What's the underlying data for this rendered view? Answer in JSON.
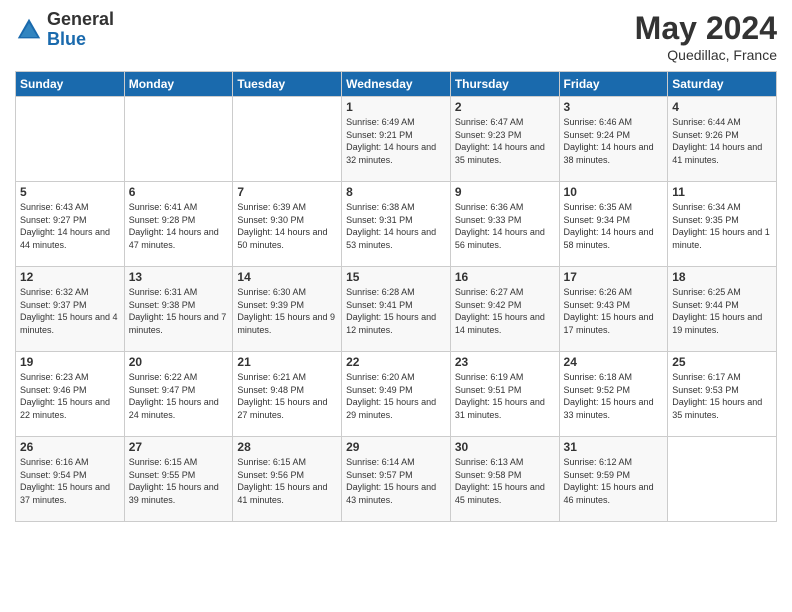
{
  "logo": {
    "general": "General",
    "blue": "Blue"
  },
  "header": {
    "month": "May 2024",
    "location": "Quedillac, France"
  },
  "days_of_week": [
    "Sunday",
    "Monday",
    "Tuesday",
    "Wednesday",
    "Thursday",
    "Friday",
    "Saturday"
  ],
  "weeks": [
    [
      {
        "day": "",
        "info": ""
      },
      {
        "day": "",
        "info": ""
      },
      {
        "day": "",
        "info": ""
      },
      {
        "day": "1",
        "info": "Sunrise: 6:49 AM\nSunset: 9:21 PM\nDaylight: 14 hours and 32 minutes."
      },
      {
        "day": "2",
        "info": "Sunrise: 6:47 AM\nSunset: 9:23 PM\nDaylight: 14 hours and 35 minutes."
      },
      {
        "day": "3",
        "info": "Sunrise: 6:46 AM\nSunset: 9:24 PM\nDaylight: 14 hours and 38 minutes."
      },
      {
        "day": "4",
        "info": "Sunrise: 6:44 AM\nSunset: 9:26 PM\nDaylight: 14 hours and 41 minutes."
      }
    ],
    [
      {
        "day": "5",
        "info": "Sunrise: 6:43 AM\nSunset: 9:27 PM\nDaylight: 14 hours and 44 minutes."
      },
      {
        "day": "6",
        "info": "Sunrise: 6:41 AM\nSunset: 9:28 PM\nDaylight: 14 hours and 47 minutes."
      },
      {
        "day": "7",
        "info": "Sunrise: 6:39 AM\nSunset: 9:30 PM\nDaylight: 14 hours and 50 minutes."
      },
      {
        "day": "8",
        "info": "Sunrise: 6:38 AM\nSunset: 9:31 PM\nDaylight: 14 hours and 53 minutes."
      },
      {
        "day": "9",
        "info": "Sunrise: 6:36 AM\nSunset: 9:33 PM\nDaylight: 14 hours and 56 minutes."
      },
      {
        "day": "10",
        "info": "Sunrise: 6:35 AM\nSunset: 9:34 PM\nDaylight: 14 hours and 58 minutes."
      },
      {
        "day": "11",
        "info": "Sunrise: 6:34 AM\nSunset: 9:35 PM\nDaylight: 15 hours and 1 minute."
      }
    ],
    [
      {
        "day": "12",
        "info": "Sunrise: 6:32 AM\nSunset: 9:37 PM\nDaylight: 15 hours and 4 minutes."
      },
      {
        "day": "13",
        "info": "Sunrise: 6:31 AM\nSunset: 9:38 PM\nDaylight: 15 hours and 7 minutes."
      },
      {
        "day": "14",
        "info": "Sunrise: 6:30 AM\nSunset: 9:39 PM\nDaylight: 15 hours and 9 minutes."
      },
      {
        "day": "15",
        "info": "Sunrise: 6:28 AM\nSunset: 9:41 PM\nDaylight: 15 hours and 12 minutes."
      },
      {
        "day": "16",
        "info": "Sunrise: 6:27 AM\nSunset: 9:42 PM\nDaylight: 15 hours and 14 minutes."
      },
      {
        "day": "17",
        "info": "Sunrise: 6:26 AM\nSunset: 9:43 PM\nDaylight: 15 hours and 17 minutes."
      },
      {
        "day": "18",
        "info": "Sunrise: 6:25 AM\nSunset: 9:44 PM\nDaylight: 15 hours and 19 minutes."
      }
    ],
    [
      {
        "day": "19",
        "info": "Sunrise: 6:23 AM\nSunset: 9:46 PM\nDaylight: 15 hours and 22 minutes."
      },
      {
        "day": "20",
        "info": "Sunrise: 6:22 AM\nSunset: 9:47 PM\nDaylight: 15 hours and 24 minutes."
      },
      {
        "day": "21",
        "info": "Sunrise: 6:21 AM\nSunset: 9:48 PM\nDaylight: 15 hours and 27 minutes."
      },
      {
        "day": "22",
        "info": "Sunrise: 6:20 AM\nSunset: 9:49 PM\nDaylight: 15 hours and 29 minutes."
      },
      {
        "day": "23",
        "info": "Sunrise: 6:19 AM\nSunset: 9:51 PM\nDaylight: 15 hours and 31 minutes."
      },
      {
        "day": "24",
        "info": "Sunrise: 6:18 AM\nSunset: 9:52 PM\nDaylight: 15 hours and 33 minutes."
      },
      {
        "day": "25",
        "info": "Sunrise: 6:17 AM\nSunset: 9:53 PM\nDaylight: 15 hours and 35 minutes."
      }
    ],
    [
      {
        "day": "26",
        "info": "Sunrise: 6:16 AM\nSunset: 9:54 PM\nDaylight: 15 hours and 37 minutes."
      },
      {
        "day": "27",
        "info": "Sunrise: 6:15 AM\nSunset: 9:55 PM\nDaylight: 15 hours and 39 minutes."
      },
      {
        "day": "28",
        "info": "Sunrise: 6:15 AM\nSunset: 9:56 PM\nDaylight: 15 hours and 41 minutes."
      },
      {
        "day": "29",
        "info": "Sunrise: 6:14 AM\nSunset: 9:57 PM\nDaylight: 15 hours and 43 minutes."
      },
      {
        "day": "30",
        "info": "Sunrise: 6:13 AM\nSunset: 9:58 PM\nDaylight: 15 hours and 45 minutes."
      },
      {
        "day": "31",
        "info": "Sunrise: 6:12 AM\nSunset: 9:59 PM\nDaylight: 15 hours and 46 minutes."
      },
      {
        "day": "",
        "info": ""
      }
    ]
  ]
}
